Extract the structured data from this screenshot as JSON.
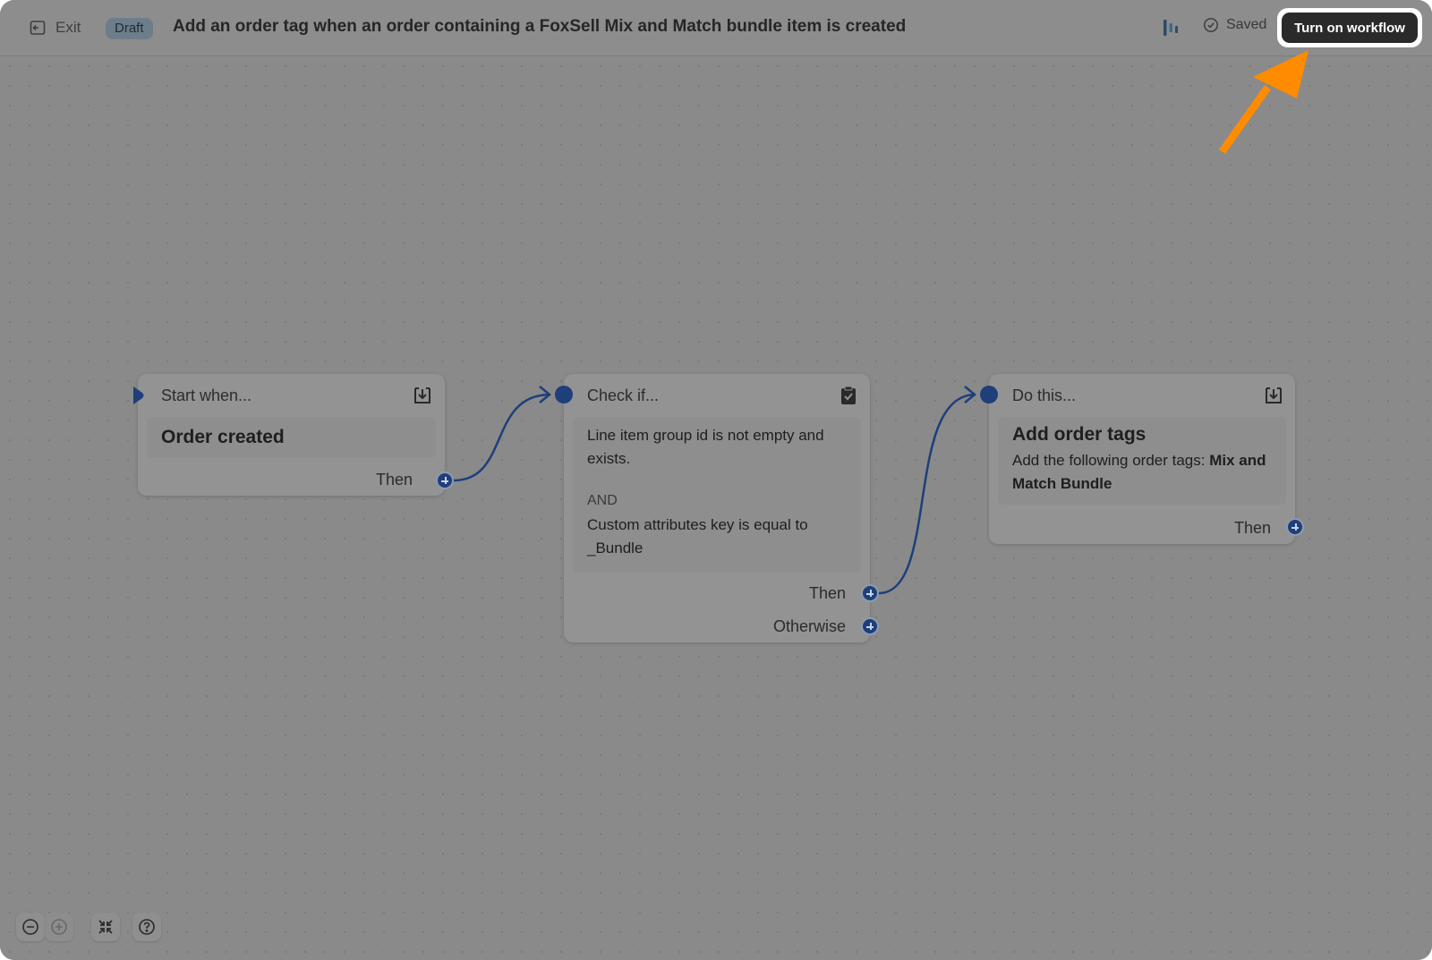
{
  "topbar": {
    "exit_label": "Exit",
    "status_badge": "Draft",
    "title": "Add an order tag when an order containing a FoxSell Mix and Match bundle item is created",
    "saved_label": "Saved",
    "turn_on_label": "Turn on workflow",
    "icons": {
      "exit": "exit-icon",
      "analytics": "bar-chart-icon",
      "saved": "check-circle-icon"
    }
  },
  "nodes": {
    "trigger": {
      "header": "Start when...",
      "name": "Order created",
      "then_label": "Then",
      "icon": "download-icon"
    },
    "condition": {
      "header": "Check if...",
      "rule1": "Line item group id is not empty and exists.",
      "operator": "AND",
      "rule2": "Custom attributes key is equal to _Bundle",
      "then_label": "Then",
      "otherwise_label": "Otherwise",
      "icon": "clipboard-check-icon"
    },
    "action": {
      "header": "Do this...",
      "name": "Add order tags",
      "description_prefix": "Add the following order tags:",
      "tag": "Mix and Match Bundle",
      "then_label": "Then",
      "icon": "download-icon"
    }
  },
  "colors": {
    "accent": "#1e3f7a",
    "annotation_arrow": "#ff8c00",
    "primary_button": "#2a2a2a"
  },
  "controls": {
    "icons": [
      "zoom-out-icon",
      "zoom-in-icon",
      "fit-view-icon",
      "help-icon"
    ]
  }
}
